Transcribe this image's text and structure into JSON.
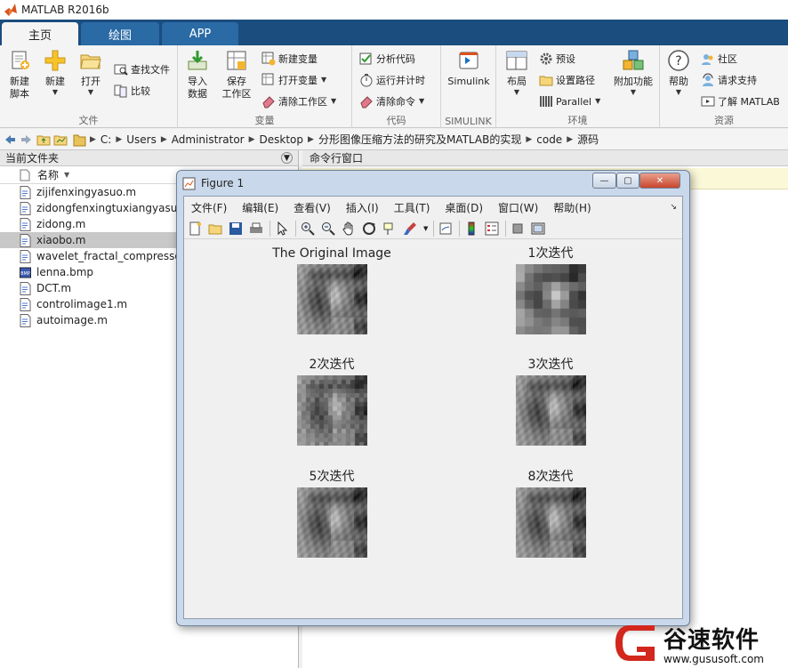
{
  "app": {
    "title": "MATLAB R2016b"
  },
  "ribbon_tabs": [
    {
      "label": "主页",
      "active": true
    },
    {
      "label": "绘图",
      "active": false
    },
    {
      "label": "APP",
      "active": false
    }
  ],
  "ribbon": {
    "file_group": {
      "label": "文件",
      "new_script": "新建\n脚本",
      "new": "新建",
      "open": "打开",
      "find_files": "查找文件",
      "compare": "比较"
    },
    "variable_group": {
      "label": "变量",
      "import_data": "导入\n数据",
      "save_workspace": "保存\n工作区",
      "new_variable": "新建变量",
      "open_variable": "打开变量",
      "clear_workspace": "清除工作区"
    },
    "code_group": {
      "label": "代码",
      "analyze_code": "分析代码",
      "run_and_time": "运行并计时",
      "clear_commands": "清除命令"
    },
    "simulink_group": {
      "label": "SIMULINK",
      "simulink": "Simulink"
    },
    "environment_group": {
      "label": "环境",
      "layout": "布局",
      "preferences": "预设",
      "set_path": "设置路径",
      "parallel": "Parallel",
      "add_ons": "附加功能"
    },
    "resources_group": {
      "label": "资源",
      "help": "帮助",
      "community": "社区",
      "request_support": "请求支持",
      "learn_matlab": "了解 MATLAB"
    }
  },
  "address_bar": {
    "path": [
      "C:",
      "Users",
      "Administrator",
      "Desktop",
      "分形图像压缩方法的研究及MATLAB的实现",
      "code",
      "源码"
    ]
  },
  "current_folder": {
    "title": "当前文件夹",
    "column_name": "名称",
    "files": [
      {
        "name": "zijifenxingyasuo.m",
        "icon": "m-file-icon",
        "selected": false
      },
      {
        "name": "zidongfenxingtuxiangyasuo",
        "icon": "m-file-icon",
        "selected": false
      },
      {
        "name": "zidong.m",
        "icon": "m-file-icon",
        "selected": false
      },
      {
        "name": "xiaobo.m",
        "icon": "m-file-icon",
        "selected": true
      },
      {
        "name": "wavelet_fractal_compressor",
        "icon": "m-file-icon",
        "selected": false
      },
      {
        "name": "lenna.bmp",
        "icon": "bmp-file-icon",
        "selected": false
      },
      {
        "name": "DCT.m",
        "icon": "m-file-icon",
        "selected": false
      },
      {
        "name": "controlimage1.m",
        "icon": "m-file-icon",
        "selected": false
      },
      {
        "name": "autoimage.m",
        "icon": "m-file-icon",
        "selected": false
      }
    ]
  },
  "command_window": {
    "title": "命令行窗口"
  },
  "figure": {
    "title": "Figure 1",
    "menu": [
      "文件(F)",
      "编辑(E)",
      "查看(V)",
      "插入(I)",
      "工具(T)",
      "桌面(D)",
      "窗口(W)",
      "帮助(H)"
    ],
    "subplots": [
      {
        "title": "The Original Image",
        "detail": "original"
      },
      {
        "title": "1次迭代",
        "detail": "pixelated"
      },
      {
        "title": "2次迭代",
        "detail": "coarse"
      },
      {
        "title": "3次迭代",
        "detail": "fine"
      },
      {
        "title": "5次迭代",
        "detail": "fine"
      },
      {
        "title": "8次迭代",
        "detail": "fine"
      }
    ]
  },
  "watermark": {
    "text": "谷速软件",
    "url": "www.gususoft.com"
  },
  "colors": {
    "ribbon_tab_bar": "#1b4d7e",
    "selected_row": "#c8c8c8",
    "figure_frame": "#c9d8ea"
  }
}
